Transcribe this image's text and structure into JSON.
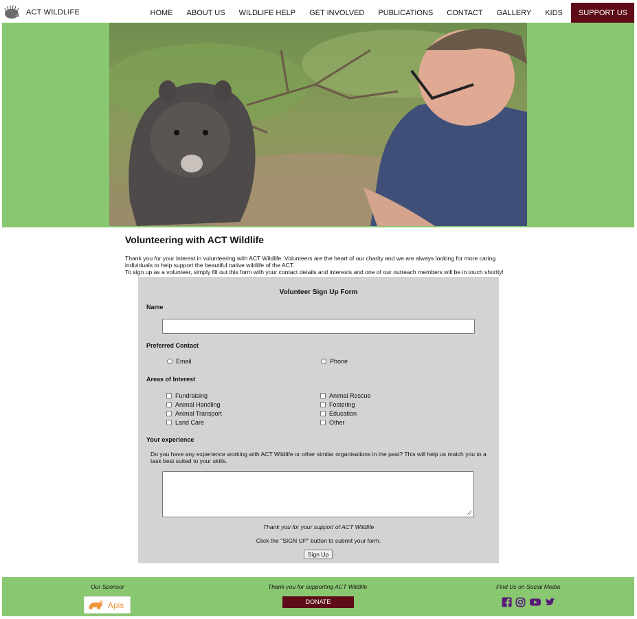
{
  "nav": {
    "brand": "ACT WILDLIFE",
    "items": [
      {
        "label": "HOME",
        "name": "nav-home"
      },
      {
        "label": "ABOUT US",
        "name": "nav-about-us"
      },
      {
        "label": "WILDLIFE HELP",
        "name": "nav-wildlife-help"
      },
      {
        "label": "GET INVOLVED",
        "name": "nav-get-involved"
      },
      {
        "label": "PUBLICATIONS",
        "name": "nav-publications"
      },
      {
        "label": "CONTACT",
        "name": "nav-contact"
      },
      {
        "label": "GALLERY",
        "name": "nav-gallery"
      },
      {
        "label": "KIDS",
        "name": "nav-kids"
      }
    ],
    "support_label": "SUPPORT US"
  },
  "intro": {
    "title": "Volunteering with ACT Wildlife",
    "para1": "Thank you for your interest in volunteering with ACT Wildlife. Volunteers are the heart of our charity and we are always looking for more caring individuals to help support the beautiful native wildlife of the ACT.",
    "para2": "To sign up as a volunteer, simply fill out this form with your contact details and interests and one of our outreach members will be in touch shortly!"
  },
  "form": {
    "title": "Volunteer Sign Up Form",
    "name_label": "Name",
    "name_value": "",
    "contact_label": "Preferred Contact",
    "contact_options": [
      "Email",
      "Phone"
    ],
    "interests_label": "Areas of Interest",
    "interests_left": [
      "Fundraising",
      "Animal Handling",
      "Animal Transport",
      "Land Care"
    ],
    "interests_right": [
      "Animal Rescue",
      "Fostering",
      "Education",
      "Other"
    ],
    "experience_label": "Your experience",
    "experience_text": "Do you have any experience working with ACT Wildlife or other similar organisations in the past? This will help us match you to a task best suited to your skills.",
    "experience_value": "",
    "thanks": "Thank you for your support of ACT Wildlife",
    "click_note": "Click the \"SIGN UP\" button to submit your form.",
    "submit_label": "Sign Up"
  },
  "footer": {
    "sponsor_label": "Our Sponsor",
    "sponsor_name": "Apis",
    "thanks_label": "Thank you for supporting ACT Wildlife",
    "donate_label": "DONATE",
    "social_label": "Find Us on Social Media",
    "social_icons": [
      "facebook-icon",
      "instagram-icon",
      "youtube-icon",
      "twitter-icon"
    ]
  },
  "colors": {
    "accent_green": "#89c771",
    "brand_maroon": "#5e0a17",
    "form_gray": "#d3d3d3",
    "social_purple": "#5a1a7a"
  }
}
